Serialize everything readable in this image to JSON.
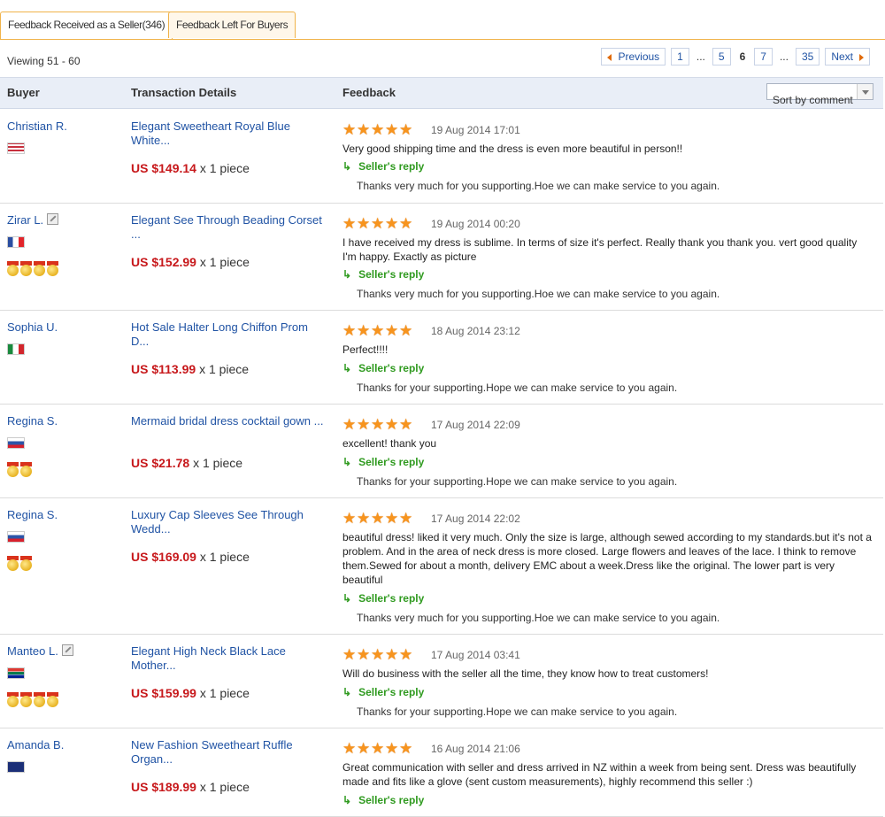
{
  "tabs": [
    "Feedback Received as a Seller(346)",
    "Feedback Left For Buyers"
  ],
  "viewing": "Viewing 51 - 60",
  "pager": {
    "previous": "Previous",
    "pages": [
      "1",
      "...",
      "5",
      "6",
      "7",
      "...",
      "35"
    ],
    "current": "6",
    "next": "Next"
  },
  "table_header": {
    "buyer": "Buyer",
    "transaction": "Transaction Details",
    "feedback": "Feedback",
    "sort": "Sort by comment"
  },
  "rows": [
    {
      "buyer": "Christian R.",
      "flag": "us-flag-icon",
      "medals": 0,
      "edit_icon": false,
      "item": "Elegant Sweetheart Royal Blue White...",
      "price": "US $149.14",
      "qty": "x 1 piece",
      "stars": 5,
      "date": "19 Aug 2014 17:01",
      "feedback": "Very good shipping time and the dress is even more beautiful in person!!",
      "reply_label": "Seller's reply",
      "reply": "Thanks very much for you supporting.Hoe we can make service to you again."
    },
    {
      "buyer": "Zirar L.",
      "flag": "france-flag-icon",
      "medals": 4,
      "edit_icon": true,
      "item": "Elegant See Through Beading Corset ...",
      "price": "US $152.99",
      "qty": "x 1 piece",
      "stars": 5,
      "date": "19 Aug 2014 00:20",
      "feedback": "I have received my dress is sublime. In terms of size it's perfect. Really thank you thank you. vert good quality I'm happy. Exactly as picture",
      "reply_label": "Seller's reply",
      "reply": "Thanks very much for you supporting.Hoe we can make service to you again."
    },
    {
      "buyer": "Sophia U.",
      "flag": "italy-flag-icon",
      "medals": 0,
      "edit_icon": false,
      "item": "Hot Sale Halter Long Chiffon Prom D...",
      "price": "US $113.99",
      "qty": "x 1 piece",
      "stars": 5,
      "date": "18 Aug 2014 23:12",
      "feedback": "Perfect!!!!",
      "reply_label": "Seller's reply",
      "reply": "Thanks for your supporting.Hope we can make service to you again."
    },
    {
      "buyer": "Regina S.",
      "flag": "russia-flag-icon",
      "medals": 2,
      "edit_icon": false,
      "item": "Mermaid bridal dress cocktail gown ...",
      "price": "US $21.78",
      "qty": "x 1 piece",
      "stars": 5,
      "date": "17 Aug 2014 22:09",
      "feedback": "excellent! thank you",
      "reply_label": "Seller's reply",
      "reply": "Thanks for your supporting.Hope we can make service to you again."
    },
    {
      "buyer": "Regina S.",
      "flag": "russia-flag-icon",
      "medals": 2,
      "edit_icon": false,
      "item": "Luxury Cap Sleeves See Through Wedd...",
      "price": "US $169.09",
      "qty": "x 1 piece",
      "stars": 5,
      "date": "17 Aug 2014 22:02",
      "feedback": "beautiful dress! liked it very much. Only the size is large, although sewed according to my standards.but it's not a problem. And in the area of neck dress is more closed. Large flowers and leaves of the lace. I think to remove them.Sewed for about a month, delivery EMC about a week.Dress like the original. The lower part is very beautiful",
      "reply_label": "Seller's reply",
      "reply": "Thanks very much for you supporting.Hoe we can make service to you again."
    },
    {
      "buyer": "Manteo L.",
      "flag": "south-africa-flag-icon",
      "medals": 4,
      "edit_icon": true,
      "item": "Elegant High Neck Black Lace Mother...",
      "price": "US $159.99",
      "qty": "x 1 piece",
      "stars": 5,
      "date": "17 Aug 2014 03:41",
      "feedback": "Will do business with the seller all the time, they know how to treat customers!",
      "reply_label": "Seller's reply",
      "reply": "Thanks for your supporting.Hope we can make service to you again."
    },
    {
      "buyer": "Amanda B.",
      "flag": "new-zealand-flag-icon",
      "medals": 0,
      "edit_icon": false,
      "item": "New Fashion Sweetheart Ruffle Organ...",
      "price": "US $189.99",
      "qty": "x 1 piece",
      "stars": 5,
      "date": "16 Aug 2014 21:06",
      "feedback": "Great communication with seller and dress arrived in NZ within a week from being sent. Dress was beautifully made and fits like a glove (sent custom measurements), highly recommend this seller :)",
      "reply_label": "Seller's reply",
      "reply": ""
    }
  ]
}
